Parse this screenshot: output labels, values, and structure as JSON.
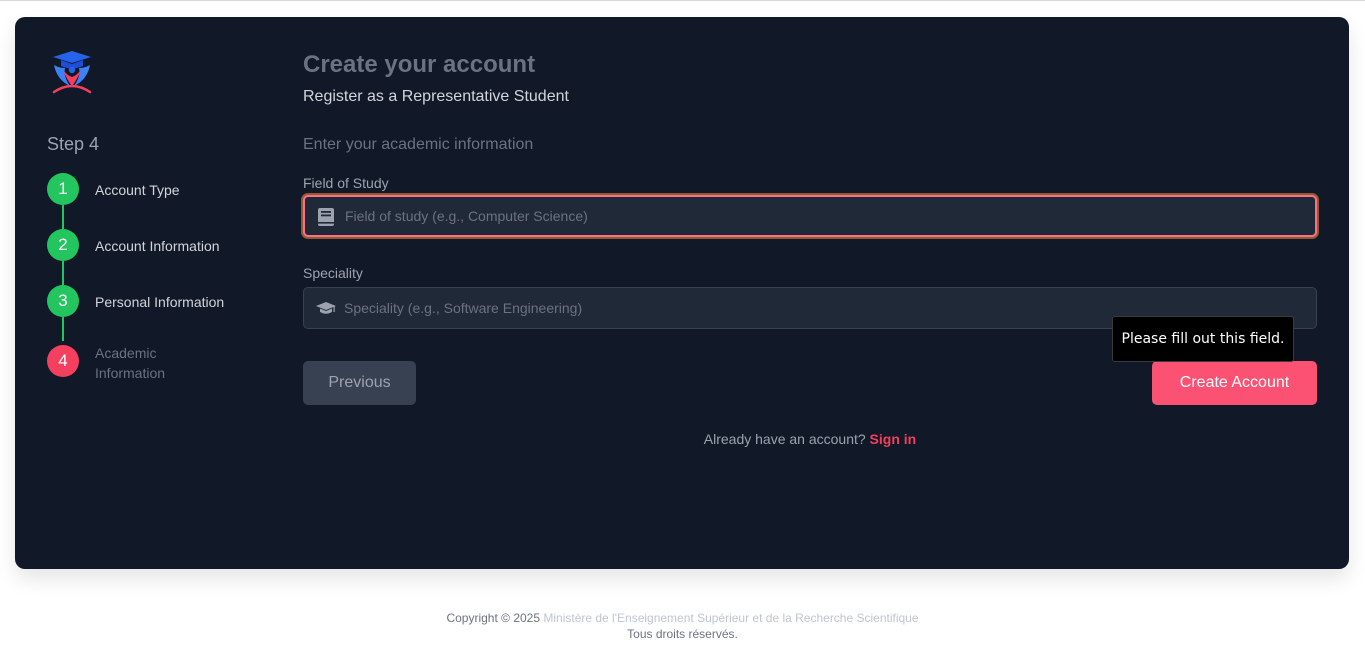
{
  "sidebar": {
    "step_title": "Step 4",
    "steps": [
      {
        "number": "1",
        "label": "Account Type",
        "status": "done"
      },
      {
        "number": "2",
        "label": "Account Information",
        "status": "done"
      },
      {
        "number": "3",
        "label": "Personal Information",
        "status": "done"
      },
      {
        "number": "4",
        "label": "Academic Information",
        "status": "current"
      }
    ]
  },
  "main": {
    "title": "Create your account",
    "subtitle": "Register as a Representative Student",
    "section_title": "Enter your academic information",
    "field_of_study": {
      "label": "Field of Study",
      "placeholder": "Field of study (e.g., Computer Science)",
      "value": "",
      "icon": "book-icon"
    },
    "speciality": {
      "label": "Speciality",
      "placeholder": "Speciality (e.g., Software Engineering)",
      "value": "",
      "icon": "graduation-cap-icon"
    },
    "previous_label": "Previous",
    "create_label": "Create Account",
    "tooltip": "Please fill out this field.",
    "signin_prompt": "Already have an account?",
    "signin_link": "Sign in"
  },
  "footer": {
    "copyright": "Copyright © 2025",
    "organization": "Ministère de l'Enseignement Supérieur et de la Recherche Scientifique",
    "rights": "Tous droits réservés."
  },
  "colors": {
    "card_bg": "#111827",
    "accent": "#f43f5e",
    "step_done": "#22c55e",
    "input_bg": "#1f2937"
  }
}
